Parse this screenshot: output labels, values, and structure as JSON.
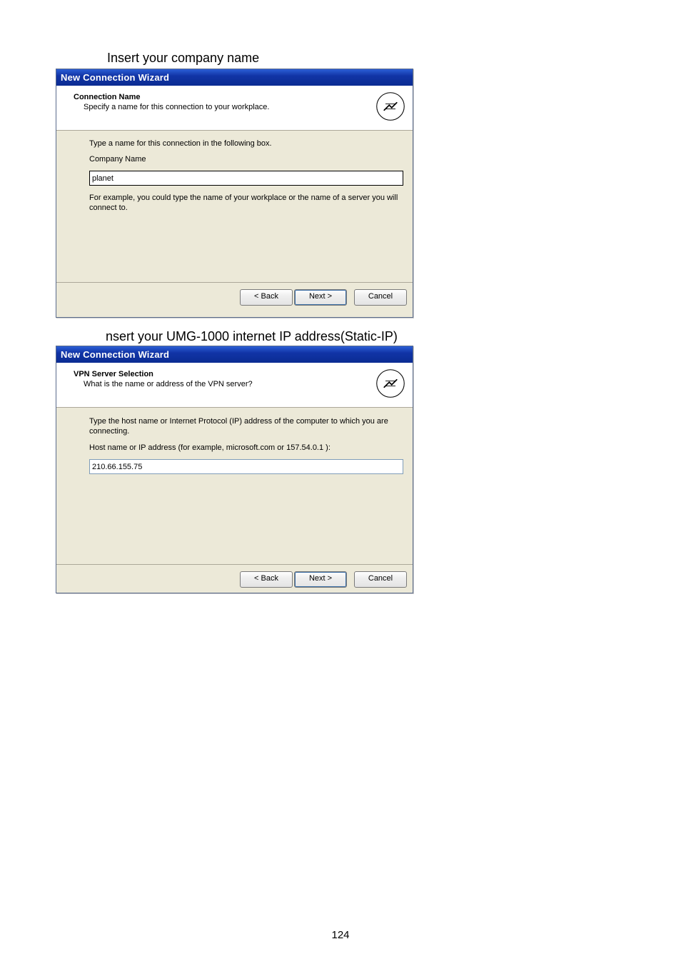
{
  "captions": {
    "c1": "Insert your company name",
    "c2": "nsert your UMG-1000 internet IP address(Static-IP)"
  },
  "wizard1": {
    "titlebar": "New Connection Wizard",
    "header_title": "Connection Name",
    "header_sub": "Specify a name for this connection to your workplace.",
    "body_instruction": "Type a name for this connection in the following box.",
    "field_label": "Company Name",
    "field_value": "planet",
    "example_text": "For example, you could type the name of your workplace or the name of a server you will connect to.",
    "buttons": {
      "back": "< Back",
      "next": "Next >",
      "cancel": "Cancel"
    }
  },
  "wizard2": {
    "titlebar": "New Connection Wizard",
    "header_title": "VPN Server Selection",
    "header_sub": "What is the name or address of the VPN server?",
    "body_instruction": "Type the host name or Internet Protocol (IP) address of the computer to which you are connecting.",
    "field_label": "Host name or IP address (for example, microsoft.com or 157.54.0.1 ):",
    "field_value": "210.66.155.75",
    "buttons": {
      "back": "< Back",
      "next": "Next >",
      "cancel": "Cancel"
    }
  },
  "page_number": "124"
}
